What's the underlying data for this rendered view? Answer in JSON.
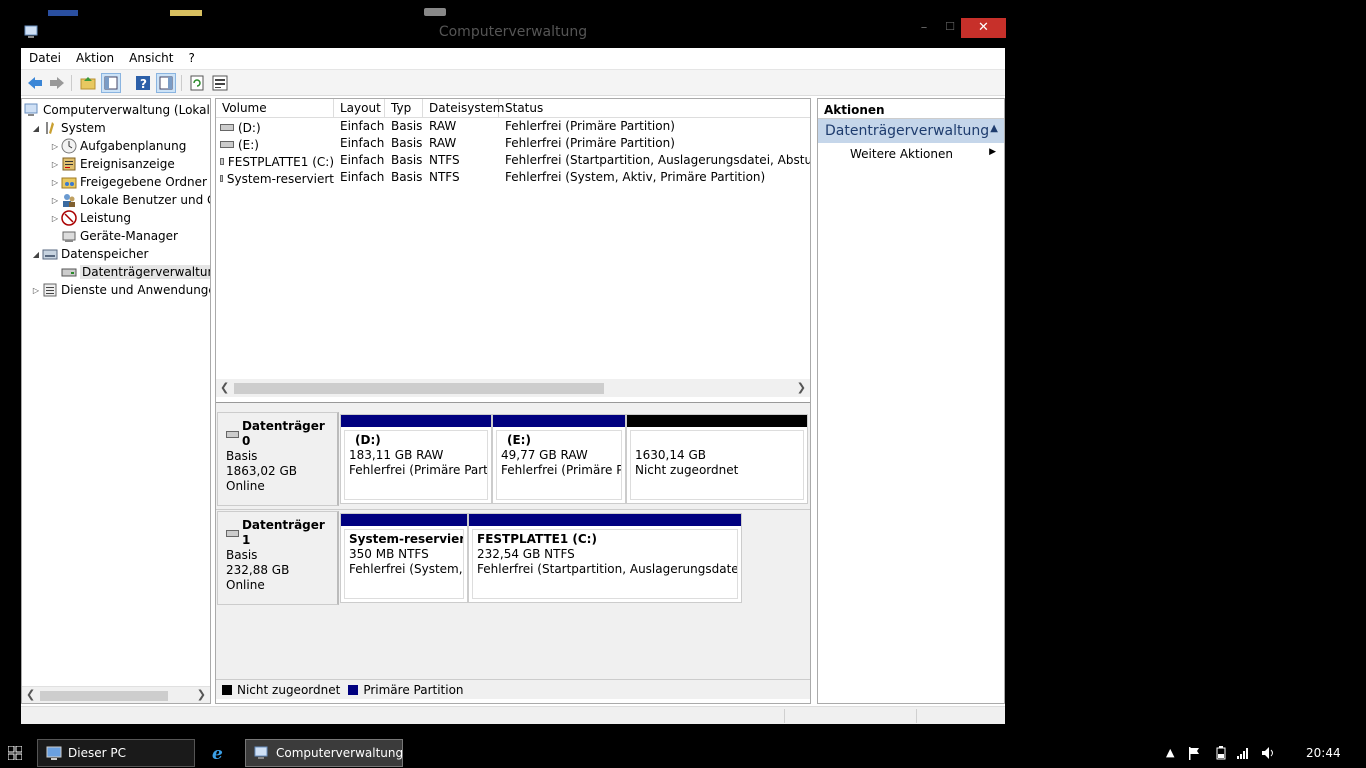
{
  "window": {
    "title": "Computerverwaltung",
    "min_glyph": "–",
    "max_glyph": "☐",
    "close_glyph": "✕"
  },
  "menu": [
    "Datei",
    "Aktion",
    "Ansicht",
    "?"
  ],
  "tree": {
    "root": "Computerverwaltung (Lokal)",
    "system": "System",
    "aufgaben": "Aufgabenplanung",
    "ereignis": "Ereignisanzeige",
    "freigegeben": "Freigegebene Ordner",
    "lokale": "Lokale Benutzer und Gruppen",
    "leistung": "Leistung",
    "geraete": "Geräte-Manager",
    "datenspeicher": "Datenspeicher",
    "datentraeger": "Datenträgerverwaltung",
    "dienste": "Dienste und Anwendungen"
  },
  "volumes": {
    "headers": [
      "Volume",
      "Layout",
      "Typ",
      "Dateisystem",
      "Status"
    ],
    "rows": [
      [
        "(D:)",
        "Einfach",
        "Basis",
        "RAW",
        "Fehlerfrei (Primäre Partition)"
      ],
      [
        "(E:)",
        "Einfach",
        "Basis",
        "RAW",
        "Fehlerfrei (Primäre Partition)"
      ],
      [
        "FESTPLATTE1 (C:)",
        "Einfach",
        "Basis",
        "NTFS",
        "Fehlerfrei (Startpartition, Auslagerungsdatei, Absturzabbild)"
      ],
      [
        "System-reserviert",
        "Einfach",
        "Basis",
        "NTFS",
        "Fehlerfrei (System, Aktiv, Primäre Partition)"
      ]
    ]
  },
  "disks": [
    {
      "name": "Datenträger 0",
      "type": "Basis",
      "size": "1863,02 GB",
      "state": "Online",
      "partitions": [
        {
          "title": "(D:)",
          "size": "183,11 GB RAW",
          "status": "Fehlerfrei (Primäre Partition)"
        },
        {
          "title": "(E:)",
          "size": "49,77 GB RAW",
          "status": "Fehlerfrei (Primäre Partition)"
        },
        {
          "title": "",
          "size": "1630,14 GB",
          "status": "Nicht zugeordnet"
        }
      ]
    },
    {
      "name": "Datenträger 1",
      "type": "Basis",
      "size": "232,88 GB",
      "state": "Online",
      "partitions": [
        {
          "title": "System-reserviert",
          "size": "350 MB NTFS",
          "status": "Fehlerfrei (System, Aktiv, Primäre Partition)"
        },
        {
          "title": "FESTPLATTE1  (C:)",
          "size": "232,54 GB NTFS",
          "status": "Fehlerfrei (Startpartition, Auslagerungsdatei, Absturzabbild)"
        }
      ]
    }
  ],
  "legend": {
    "unallocated": "Nicht zugeordnet",
    "primary": "Primäre Partition"
  },
  "colors": {
    "primary": "#00007f",
    "unallocated": "#000000"
  },
  "actions": {
    "header": "Aktionen",
    "section": "Datenträgerverwaltung",
    "more": "Weitere Aktionen"
  },
  "taskbar": {
    "pc": "Dieser PC",
    "mgmt": "Computerverwaltung",
    "clock": "20:44"
  }
}
